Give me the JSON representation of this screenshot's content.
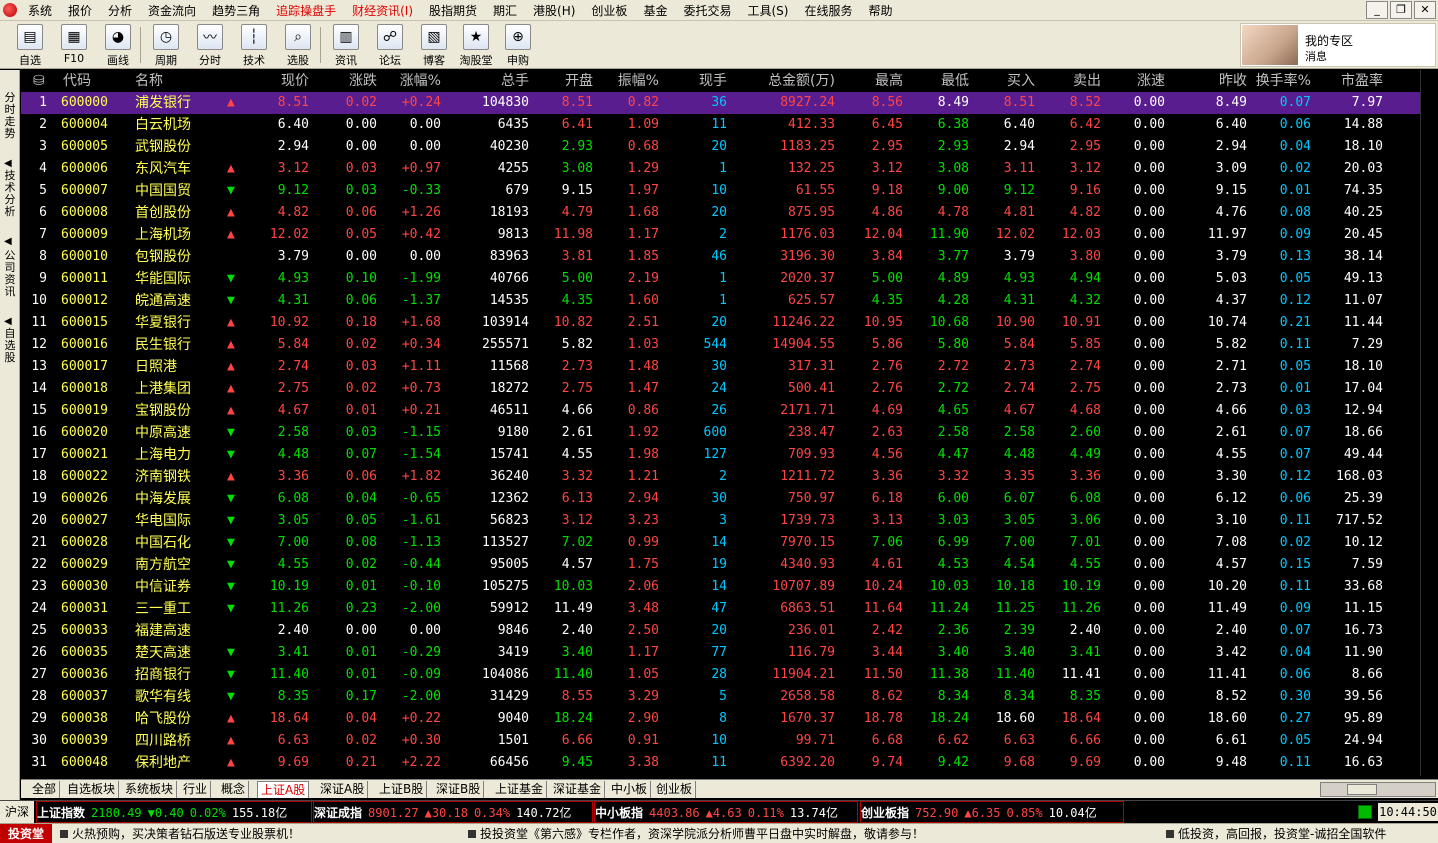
{
  "menu": {
    "items": [
      {
        "label": "系统",
        "red": false
      },
      {
        "label": "报价",
        "red": false
      },
      {
        "label": "分析",
        "red": false
      },
      {
        "label": "资金流向",
        "red": false
      },
      {
        "label": "趋势三角",
        "red": false
      },
      {
        "label": "追踪操盘手",
        "red": true
      },
      {
        "label": "财经资讯(I)",
        "red": true
      },
      {
        "label": "股指期货",
        "red": false
      },
      {
        "label": "期汇",
        "red": false
      },
      {
        "label": "港股(H)",
        "red": false
      },
      {
        "label": "创业板",
        "red": false
      },
      {
        "label": "基金",
        "red": false
      },
      {
        "label": "委托交易",
        "red": false
      },
      {
        "label": "工具(S)",
        "red": false
      },
      {
        "label": "在线服务",
        "red": false
      },
      {
        "label": "帮助",
        "red": false
      }
    ]
  },
  "toolbar": {
    "buttons": [
      {
        "label": "自选",
        "icon": "watchlist-icon",
        "glyph": "▤"
      },
      {
        "label": "F10",
        "icon": "f10-icon",
        "glyph": "▦"
      },
      {
        "label": "画线",
        "icon": "pie-chart-icon",
        "glyph": "◕"
      },
      {
        "label": "周期",
        "icon": "clock-icon",
        "glyph": "◷"
      },
      {
        "label": "分时",
        "icon": "line-chart-icon",
        "glyph": "〰"
      },
      {
        "label": "技术",
        "icon": "candlestick-icon",
        "glyph": "┆"
      },
      {
        "label": "选股",
        "icon": "stock-filter-icon",
        "glyph": "⌕"
      },
      {
        "label": "资讯",
        "icon": "news-icon",
        "glyph": "▥"
      },
      {
        "label": "论坛",
        "icon": "forum-icon",
        "glyph": "☍"
      },
      {
        "label": "博客",
        "icon": "blog-icon",
        "glyph": "▧"
      },
      {
        "label": "淘股堂",
        "icon": "star-icon",
        "glyph": "★"
      },
      {
        "label": "申购",
        "icon": "subscribe-icon",
        "glyph": "⊕"
      }
    ],
    "user_zone": {
      "line1": "我的专区",
      "line2": "消息"
    }
  },
  "sidebar": {
    "tabs": [
      "分时走势",
      "技术分析",
      "公司资讯",
      "自选股"
    ]
  },
  "table": {
    "headers": [
      "代码",
      "名称",
      "现价",
      "涨跌",
      "涨幅%",
      "总手",
      "开盘",
      "振幅%",
      "现手",
      "总金额(万)",
      "最高",
      "最低",
      "买入",
      "卖出",
      "涨速",
      "昨收",
      "换手率%",
      "市盈率"
    ],
    "selected_row": 1,
    "rows": [
      [
        1,
        "600000",
        "浦发银行",
        "up",
        "8.51",
        "0.02",
        "+0.24",
        "104830",
        "8.51",
        "0.82",
        "36",
        "8927.24",
        "8.56",
        "8.49",
        "8.51",
        "8.52",
        "0.00",
        "8.49",
        "0.07",
        "7.97"
      ],
      [
        2,
        "600004",
        "白云机场",
        "flat",
        "6.40",
        "0.00",
        "0.00",
        "6435",
        "6.41",
        "1.09",
        "11",
        "412.33",
        "6.45",
        "6.38",
        "6.40",
        "6.42",
        "0.00",
        "6.40",
        "0.06",
        "14.88"
      ],
      [
        3,
        "600005",
        "武钢股份",
        "flat",
        "2.94",
        "0.00",
        "0.00",
        "40230",
        "2.93",
        "0.68",
        "20",
        "1183.25",
        "2.95",
        "2.93",
        "2.94",
        "2.95",
        "0.00",
        "2.94",
        "0.04",
        "18.10"
      ],
      [
        4,
        "600006",
        "东风汽车",
        "up",
        "3.12",
        "0.03",
        "+0.97",
        "4255",
        "3.08",
        "1.29",
        "1",
        "132.25",
        "3.12",
        "3.08",
        "3.11",
        "3.12",
        "0.00",
        "3.09",
        "0.02",
        "20.03"
      ],
      [
        5,
        "600007",
        "中国国贸",
        "down",
        "9.12",
        "0.03",
        "-0.33",
        "679",
        "9.15",
        "1.97",
        "10",
        "61.55",
        "9.18",
        "9.00",
        "9.12",
        "9.16",
        "0.00",
        "9.15",
        "0.01",
        "74.35"
      ],
      [
        6,
        "600008",
        "首创股份",
        "up",
        "4.82",
        "0.06",
        "+1.26",
        "18193",
        "4.79",
        "1.68",
        "20",
        "875.95",
        "4.86",
        "4.78",
        "4.81",
        "4.82",
        "0.00",
        "4.76",
        "0.08",
        "40.25"
      ],
      [
        7,
        "600009",
        "上海机场",
        "up",
        "12.02",
        "0.05",
        "+0.42",
        "9813",
        "11.98",
        "1.17",
        "2",
        "1176.03",
        "12.04",
        "11.90",
        "12.02",
        "12.03",
        "0.00",
        "11.97",
        "0.09",
        "20.45"
      ],
      [
        8,
        "600010",
        "包钢股份",
        "flat",
        "3.79",
        "0.00",
        "0.00",
        "83963",
        "3.81",
        "1.85",
        "46",
        "3196.30",
        "3.84",
        "3.77",
        "3.79",
        "3.80",
        "0.00",
        "3.79",
        "0.13",
        "38.14"
      ],
      [
        9,
        "600011",
        "华能国际",
        "down",
        "4.93",
        "0.10",
        "-1.99",
        "40766",
        "5.00",
        "2.19",
        "1",
        "2020.37",
        "5.00",
        "4.89",
        "4.93",
        "4.94",
        "0.00",
        "5.03",
        "0.05",
        "49.13"
      ],
      [
        10,
        "600012",
        "皖通高速",
        "down",
        "4.31",
        "0.06",
        "-1.37",
        "14535",
        "4.35",
        "1.60",
        "1",
        "625.57",
        "4.35",
        "4.28",
        "4.31",
        "4.32",
        "0.00",
        "4.37",
        "0.12",
        "11.07"
      ],
      [
        11,
        "600015",
        "华夏银行",
        "up",
        "10.92",
        "0.18",
        "+1.68",
        "103914",
        "10.82",
        "2.51",
        "20",
        "11246.22",
        "10.95",
        "10.68",
        "10.90",
        "10.91",
        "0.00",
        "10.74",
        "0.21",
        "11.44"
      ],
      [
        12,
        "600016",
        "民生银行",
        "up",
        "5.84",
        "0.02",
        "+0.34",
        "255571",
        "5.82",
        "1.03",
        "544",
        "14904.55",
        "5.86",
        "5.80",
        "5.84",
        "5.85",
        "0.00",
        "5.82",
        "0.11",
        "7.29"
      ],
      [
        13,
        "600017",
        "日照港",
        "up",
        "2.74",
        "0.03",
        "+1.11",
        "11568",
        "2.73",
        "1.48",
        "30",
        "317.31",
        "2.76",
        "2.72",
        "2.73",
        "2.74",
        "0.00",
        "2.71",
        "0.05",
        "18.10"
      ],
      [
        14,
        "600018",
        "上港集团",
        "up",
        "2.75",
        "0.02",
        "+0.73",
        "18272",
        "2.75",
        "1.47",
        "24",
        "500.41",
        "2.76",
        "2.72",
        "2.74",
        "2.75",
        "0.00",
        "2.73",
        "0.01",
        "17.04"
      ],
      [
        15,
        "600019",
        "宝钢股份",
        "up",
        "4.67",
        "0.01",
        "+0.21",
        "46511",
        "4.66",
        "0.86",
        "26",
        "2171.71",
        "4.69",
        "4.65",
        "4.67",
        "4.68",
        "0.00",
        "4.66",
        "0.03",
        "12.94"
      ],
      [
        16,
        "600020",
        "中原高速",
        "down",
        "2.58",
        "0.03",
        "-1.15",
        "9180",
        "2.61",
        "1.92",
        "600",
        "238.47",
        "2.63",
        "2.58",
        "2.58",
        "2.60",
        "0.00",
        "2.61",
        "0.07",
        "18.66"
      ],
      [
        17,
        "600021",
        "上海电力",
        "down",
        "4.48",
        "0.07",
        "-1.54",
        "15741",
        "4.55",
        "1.98",
        "127",
        "709.93",
        "4.56",
        "4.47",
        "4.48",
        "4.49",
        "0.00",
        "4.55",
        "0.07",
        "49.44"
      ],
      [
        18,
        "600022",
        "济南钢铁",
        "up",
        "3.36",
        "0.06",
        "+1.82",
        "36240",
        "3.32",
        "1.21",
        "2",
        "1211.72",
        "3.36",
        "3.32",
        "3.35",
        "3.36",
        "0.00",
        "3.30",
        "0.12",
        "168.03"
      ],
      [
        19,
        "600026",
        "中海发展",
        "down",
        "6.08",
        "0.04",
        "-0.65",
        "12362",
        "6.13",
        "2.94",
        "30",
        "750.97",
        "6.18",
        "6.00",
        "6.07",
        "6.08",
        "0.00",
        "6.12",
        "0.06",
        "25.39"
      ],
      [
        20,
        "600027",
        "华电国际",
        "down",
        "3.05",
        "0.05",
        "-1.61",
        "56823",
        "3.12",
        "3.23",
        "3",
        "1739.73",
        "3.13",
        "3.03",
        "3.05",
        "3.06",
        "0.00",
        "3.10",
        "0.11",
        "717.52"
      ],
      [
        21,
        "600028",
        "中国石化",
        "down",
        "7.00",
        "0.08",
        "-1.13",
        "113527",
        "7.02",
        "0.99",
        "14",
        "7970.15",
        "7.06",
        "6.99",
        "7.00",
        "7.01",
        "0.00",
        "7.08",
        "0.02",
        "10.12"
      ],
      [
        22,
        "600029",
        "南方航空",
        "down",
        "4.55",
        "0.02",
        "-0.44",
        "95005",
        "4.57",
        "1.75",
        "19",
        "4340.93",
        "4.61",
        "4.53",
        "4.54",
        "4.55",
        "0.00",
        "4.57",
        "0.15",
        "7.59"
      ],
      [
        23,
        "600030",
        "中信证券",
        "down",
        "10.19",
        "0.01",
        "-0.10",
        "105275",
        "10.03",
        "2.06",
        "14",
        "10707.89",
        "10.24",
        "10.03",
        "10.18",
        "10.19",
        "0.00",
        "10.20",
        "0.11",
        "33.68"
      ],
      [
        24,
        "600031",
        "三一重工",
        "down",
        "11.26",
        "0.23",
        "-2.00",
        "59912",
        "11.49",
        "3.48",
        "47",
        "6863.51",
        "11.64",
        "11.24",
        "11.25",
        "11.26",
        "0.00",
        "11.49",
        "0.09",
        "11.15"
      ],
      [
        25,
        "600033",
        "福建高速",
        "flat",
        "2.40",
        "0.00",
        "0.00",
        "9846",
        "2.40",
        "2.50",
        "20",
        "236.01",
        "2.42",
        "2.36",
        "2.39",
        "2.40",
        "0.00",
        "2.40",
        "0.07",
        "16.73"
      ],
      [
        26,
        "600035",
        "楚天高速",
        "down",
        "3.41",
        "0.01",
        "-0.29",
        "3419",
        "3.40",
        "1.17",
        "77",
        "116.79",
        "3.44",
        "3.40",
        "3.40",
        "3.41",
        "0.00",
        "3.42",
        "0.04",
        "11.90"
      ],
      [
        27,
        "600036",
        "招商银行",
        "down",
        "11.40",
        "0.01",
        "-0.09",
        "104086",
        "11.40",
        "1.05",
        "28",
        "11904.21",
        "11.50",
        "11.38",
        "11.40",
        "11.41",
        "0.00",
        "11.41",
        "0.06",
        "8.66"
      ],
      [
        28,
        "600037",
        "歌华有线",
        "down",
        "8.35",
        "0.17",
        "-2.00",
        "31429",
        "8.55",
        "3.29",
        "5",
        "2658.58",
        "8.62",
        "8.34",
        "8.34",
        "8.35",
        "0.00",
        "8.52",
        "0.30",
        "39.56"
      ],
      [
        29,
        "600038",
        "哈飞股份",
        "up",
        "18.64",
        "0.04",
        "+0.22",
        "9040",
        "18.24",
        "2.90",
        "8",
        "1670.37",
        "18.78",
        "18.24",
        "18.60",
        "18.64",
        "0.00",
        "18.60",
        "0.27",
        "95.89"
      ],
      [
        30,
        "600039",
        "四川路桥",
        "up",
        "6.63",
        "0.02",
        "+0.30",
        "1501",
        "6.66",
        "0.91",
        "10",
        "99.71",
        "6.68",
        "6.62",
        "6.63",
        "6.66",
        "0.00",
        "6.61",
        "0.05",
        "24.94"
      ],
      [
        31,
        "600048",
        "保利地产",
        "up",
        "9.69",
        "0.21",
        "+2.22",
        "66456",
        "9.45",
        "3.38",
        "11",
        "6392.20",
        "9.74",
        "9.42",
        "9.68",
        "9.69",
        "0.00",
        "9.48",
        "0.11",
        "16.63"
      ]
    ]
  },
  "bottom_tabs": {
    "items": [
      "全部",
      "自选板块",
      "系统板块",
      "行业",
      "概念",
      "上证A股",
      "深证A股",
      "上证B股",
      "深证B股",
      "上证基金",
      "深证基金",
      "中小板",
      "创业板"
    ],
    "active": "上证A股"
  },
  "ticker": {
    "region_label": "沪深",
    "indices": [
      {
        "name": "上证指数",
        "value": "2180.49",
        "change": "▼0.40",
        "pct": "0.02%",
        "amount": "155.18亿",
        "dir": "down"
      },
      {
        "name": "深证成指",
        "value": "8901.27",
        "change": "▲30.18",
        "pct": "0.34%",
        "amount": "140.72亿",
        "dir": "up"
      },
      {
        "name": "中小板指",
        "value": "4403.86",
        "change": "▲4.63",
        "pct": "0.11%",
        "amount": "13.74亿",
        "dir": "up"
      },
      {
        "name": "创业板指",
        "value": "752.90",
        "change": "▲6.35",
        "pct": "0.85%",
        "amount": "10.04亿",
        "dir": "up"
      }
    ],
    "clock": "10:44:50"
  },
  "news": {
    "brand": "投资堂",
    "items": [
      "火热预购，买决策者钻石版送专业股票机！",
      "投投资堂《第六感》专栏作者，资深学院派分析师曹平日盘中实时解盘，敬请参与！",
      "低投资，高回报，投资堂-诚招全国软件"
    ]
  },
  "colors": {
    "up": "#ff4545",
    "down": "#00e000",
    "flat": "#ffffff",
    "selected": "#5a1d8f",
    "code": "#ffff55",
    "name": "#ffff55",
    "volume": "#00c8ff"
  }
}
